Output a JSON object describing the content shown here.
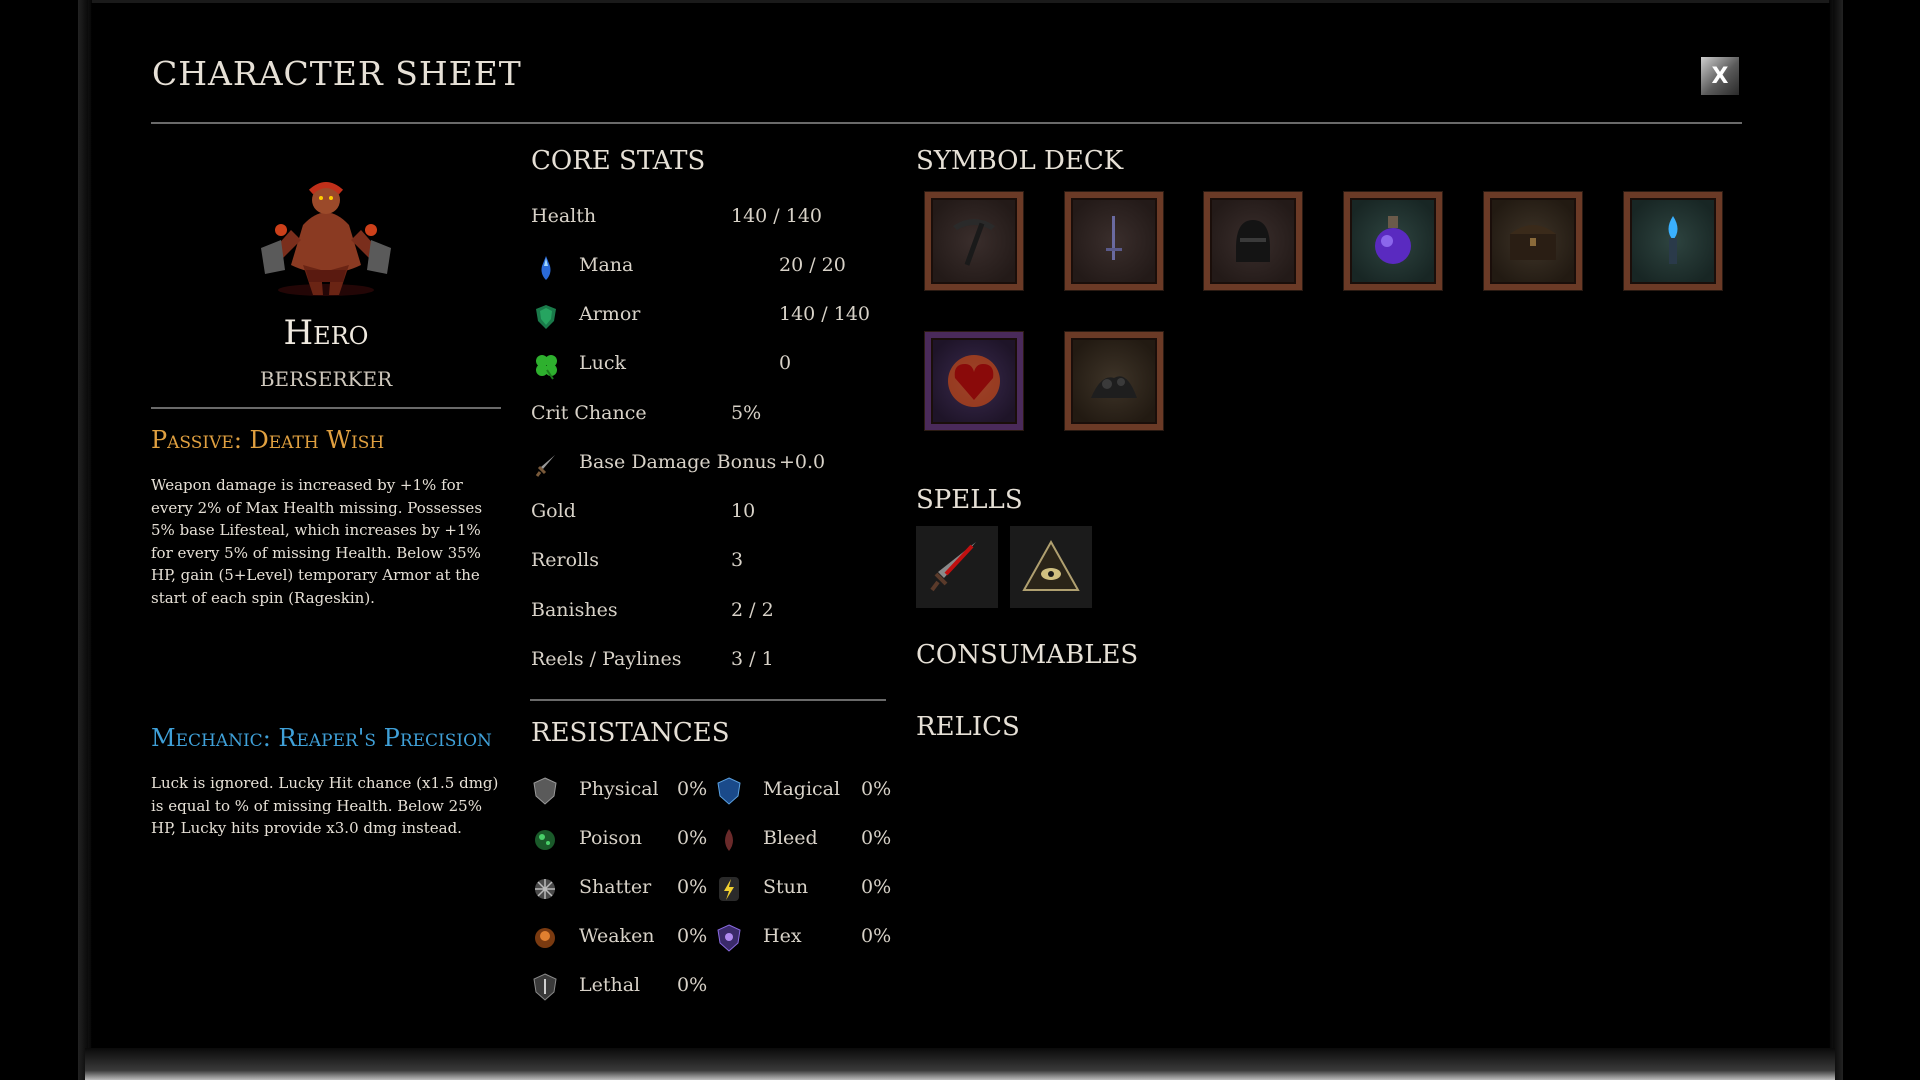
{
  "window": {
    "title": "CHARACTER SHEET",
    "close_label": "X"
  },
  "hero": {
    "name": "Hero",
    "class": "BERSERKER",
    "passive": {
      "title": "Passive: Death Wish",
      "text": "Weapon damage is increased by +1% for every 2% of Max Health missing. Possesses 5% base Lifesteal, which increases by +1% for every 5% of missing Health. Below 35% HP, gain (5+Level) temporary Armor at the start of each spin (Rageskin)."
    },
    "mechanic": {
      "title": "Mechanic: Reaper's Precision",
      "text": "Luck is ignored. Lucky Hit chance (x1.5 dmg) is equal to % of missing Health. Below 25% HP, Lucky hits provide x3.0 dmg instead."
    }
  },
  "core_stats": {
    "title": "CORE STATS",
    "health": {
      "label": "Health",
      "value": "140 / 140"
    },
    "mana": {
      "label": "Mana",
      "value": "20 / 20",
      "icon": "mana-potion-icon"
    },
    "armor": {
      "label": "Armor",
      "value": "140 / 140",
      "icon": "armor-shield-icon"
    },
    "luck": {
      "label": "Luck",
      "value": "0",
      "icon": "clover-icon"
    },
    "crit": {
      "label": "Crit Chance",
      "value": "5%"
    },
    "base_damage": {
      "label": "Base Damage Bonus",
      "value": "+0.0",
      "icon": "sword-icon"
    },
    "gold": {
      "label": "Gold",
      "value": "10"
    },
    "rerolls": {
      "label": "Rerolls",
      "value": "3"
    },
    "banishes": {
      "label": "Banishes",
      "value": "2 / 2"
    },
    "reels": {
      "label": "Reels / Paylines",
      "value": "3 / 1"
    }
  },
  "resistances": {
    "title": "RESISTANCES",
    "physical": {
      "name": "Physical",
      "value": "0%",
      "icon": "physical-shield-icon"
    },
    "magical": {
      "name": "Magical",
      "value": "0%",
      "icon": "magical-shield-icon"
    },
    "poison": {
      "name": "Poison",
      "value": "0%",
      "icon": "poison-icon"
    },
    "bleed": {
      "name": "Bleed",
      "value": "0%",
      "icon": "bleed-icon"
    },
    "shatter": {
      "name": "Shatter",
      "value": "0%",
      "icon": "shatter-icon"
    },
    "stun": {
      "name": "Stun",
      "value": "0%",
      "icon": "stun-lightning-icon"
    },
    "weaken": {
      "name": "Weaken",
      "value": "0%",
      "icon": "weaken-icon"
    },
    "hex": {
      "name": "Hex",
      "value": "0%",
      "icon": "hex-icon"
    },
    "lethal": {
      "name": "Lethal",
      "value": "0%",
      "icon": "lethal-icon"
    }
  },
  "symbol_deck": {
    "title": "SYMBOL DECK",
    "cards": [
      "pickaxe-icon",
      "dagger-icon",
      "knight-helmet-icon",
      "mana-potion-icon",
      "treasure-chest-icon",
      "blue-torch-icon",
      "heart-icon",
      "rubble-pile-icon"
    ]
  },
  "spells": {
    "title": "SPELLS",
    "items": [
      "blood-blade-icon",
      "eye-pyramid-icon"
    ]
  },
  "consumables": {
    "title": "CONSUMABLES"
  },
  "relics": {
    "title": "RELICS"
  }
}
